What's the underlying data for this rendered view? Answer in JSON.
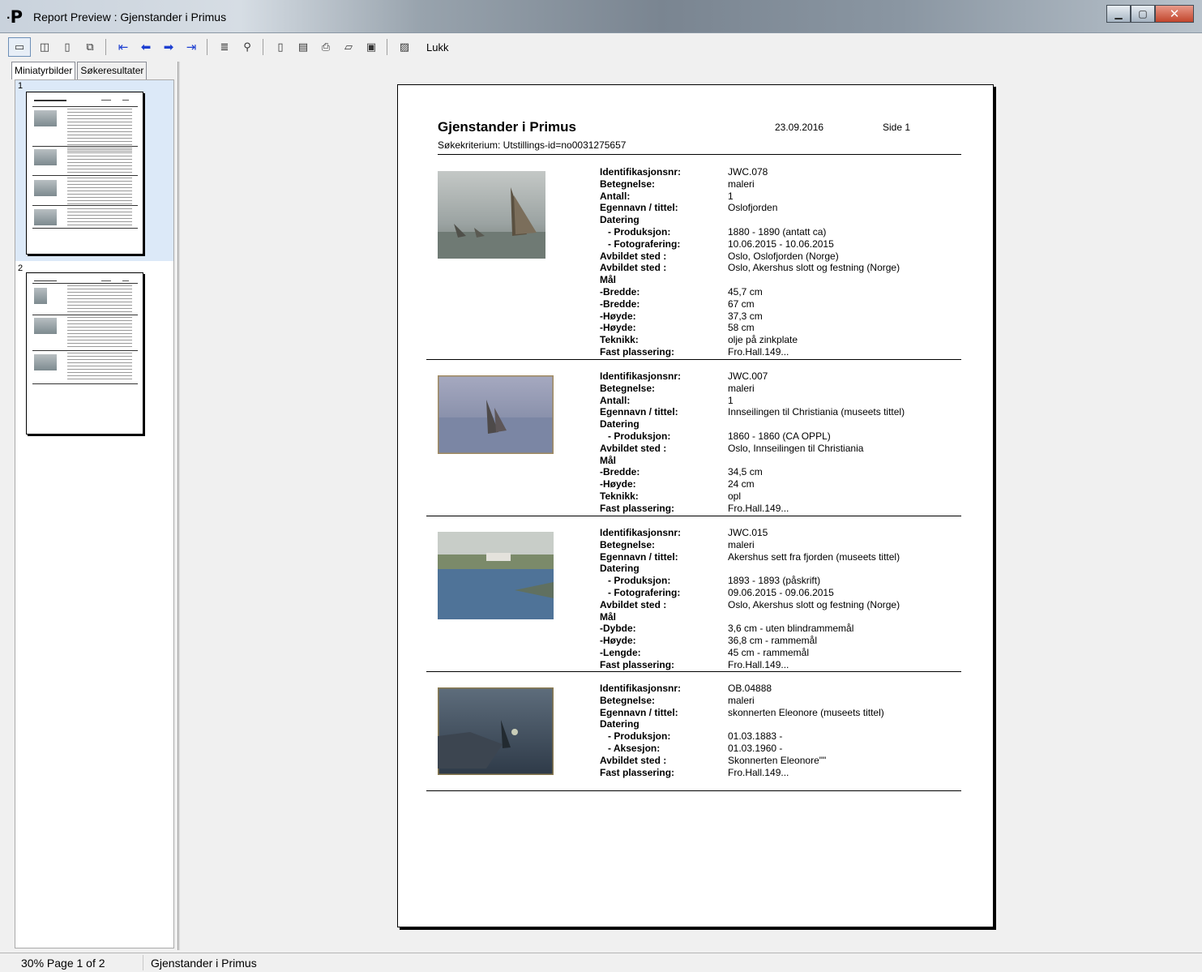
{
  "window": {
    "title": "Report Preview : Gjenstander i Primus",
    "app_icon": "P",
    "controls": [
      "minimize",
      "maximize",
      "close"
    ]
  },
  "toolbar": {
    "close_label": "Lukk",
    "icons": [
      "single-page-icon",
      "two-pages-icon",
      "page-width-icon",
      "multi-page-icon",
      "first-page-icon",
      "previous-page-icon",
      "next-page-icon",
      "last-page-icon",
      "goto-page-icon",
      "find-icon",
      "new-page-icon",
      "print-setup-icon",
      "print-icon",
      "open-icon",
      "save-icon",
      "export-icon"
    ]
  },
  "left_panel": {
    "tabs": [
      "Miniatyrbilder",
      "Søkeresultater"
    ],
    "active_tab": "Miniatyrbilder",
    "thumbnails": [
      {
        "number": "1"
      },
      {
        "number": "2"
      }
    ]
  },
  "report": {
    "title": "Gjenstander i Primus",
    "date": "23.09.2016",
    "page_label": "Side 1",
    "criterion": "Søkekriterium: Utstillings-id=no0031275657",
    "records": [
      {
        "image_desc": "seascape with sailing ship",
        "fields": [
          {
            "label": "Identifikasjonsnr:",
            "value": "JWC.078",
            "sub": false
          },
          {
            "label": "Betegnelse:",
            "value": "maleri",
            "sub": false
          },
          {
            "label": "Antall:",
            "value": "1",
            "sub": false
          },
          {
            "label": "Egennavn / tittel:",
            "value": "Oslofjorden",
            "sub": false
          },
          {
            "label": "Datering",
            "value": "",
            "sub": false
          },
          {
            "label": "- Produksjon:",
            "value": "1880 - 1890 (antatt ca)",
            "sub": true
          },
          {
            "label": "- Fotografering:",
            "value": "10.06.2015 - 10.06.2015",
            "sub": true
          },
          {
            "label": "Avbildet sted :",
            "value": "Oslo, Oslofjorden (Norge)",
            "sub": false
          },
          {
            "label": "Avbildet sted :",
            "value": "Oslo, Akershus slott og festning (Norge)",
            "sub": false
          },
          {
            "label": "Mål",
            "value": "",
            "sub": false
          },
          {
            "label": "-Bredde:",
            "value": "45,7 cm",
            "sub": false
          },
          {
            "label": "-Bredde:",
            "value": "67 cm",
            "sub": false
          },
          {
            "label": "-Høyde:",
            "value": "37,3 cm",
            "sub": false
          },
          {
            "label": "-Høyde:",
            "value": "58 cm",
            "sub": false
          },
          {
            "label": "Teknikk:",
            "value": "olje på zinkplate",
            "sub": false
          },
          {
            "label": "Fast plassering:",
            "value": "Fro.Hall.149...",
            "sub": false
          }
        ]
      },
      {
        "image_desc": "harbour entrance painting",
        "fields": [
          {
            "label": "Identifikasjonsnr:",
            "value": "JWC.007",
            "sub": false
          },
          {
            "label": "Betegnelse:",
            "value": "maleri",
            "sub": false
          },
          {
            "label": "Antall:",
            "value": "1",
            "sub": false
          },
          {
            "label": "Egennavn / tittel:",
            "value": "Innseilingen til Christiania (museets tittel)",
            "sub": false
          },
          {
            "label": "Datering",
            "value": "",
            "sub": false
          },
          {
            "label": "- Produksjon:",
            "value": "1860 - 1860 (CA OPPL)",
            "sub": true
          },
          {
            "label": "Avbildet sted :",
            "value": "Oslo, Innseilingen til Christiania",
            "sub": false
          },
          {
            "label": "Mål",
            "value": "",
            "sub": false
          },
          {
            "label": "-Bredde:",
            "value": "34,5 cm",
            "sub": false
          },
          {
            "label": "-Høyde:",
            "value": "24 cm",
            "sub": false
          },
          {
            "label": "Teknikk:",
            "value": "opl",
            "sub": false
          },
          {
            "label": "Fast plassering:",
            "value": "Fro.Hall.149...",
            "sub": false
          }
        ]
      },
      {
        "image_desc": "Akershus from the fjord",
        "fields": [
          {
            "label": "Identifikasjonsnr:",
            "value": "JWC.015",
            "sub": false
          },
          {
            "label": "Betegnelse:",
            "value": "maleri",
            "sub": false
          },
          {
            "label": "Egennavn / tittel:",
            "value": "Akershus sett fra fjorden (museets tittel)",
            "sub": false
          },
          {
            "label": "Datering",
            "value": "",
            "sub": false
          },
          {
            "label": "- Produksjon:",
            "value": "1893 - 1893 (påskrift)",
            "sub": true
          },
          {
            "label": "- Fotografering:",
            "value": "09.06.2015 - 09.06.2015",
            "sub": true
          },
          {
            "label": "Avbildet sted :",
            "value": "Oslo, Akershus slott og festning (Norge)",
            "sub": false
          },
          {
            "label": "Mål",
            "value": "",
            "sub": false
          },
          {
            "label": "-Dybde:",
            "value": "3,6 cm - uten blindrammemål",
            "sub": false
          },
          {
            "label": "-Høyde:",
            "value": "36,8 cm - rammemål",
            "sub": false
          },
          {
            "label": "-Lengde:",
            "value": "45 cm - rammemål",
            "sub": false
          },
          {
            "label": "Fast plassering:",
            "value": "Fro.Hall.149...",
            "sub": false
          }
        ]
      },
      {
        "image_desc": "schooner Eleonore at night",
        "fields": [
          {
            "label": "Identifikasjonsnr:",
            "value": "OB.04888",
            "sub": false
          },
          {
            "label": "Betegnelse:",
            "value": "maleri",
            "sub": false
          },
          {
            "label": "Egennavn / tittel:",
            "value": "skonnerten Eleonore (museets tittel)",
            "sub": false
          },
          {
            "label": "Datering",
            "value": "",
            "sub": false
          },
          {
            "label": "- Produksjon:",
            "value": "01.03.1883 -",
            "sub": true
          },
          {
            "label": "- Aksesjon:",
            "value": "01.03.1960 -",
            "sub": true
          },
          {
            "label": "Avbildet sted :",
            "value": "Skonnerten Eleonore\"\"",
            "sub": false
          },
          {
            "label": "Fast plassering:",
            "value": "Fro.Hall.149...",
            "sub": false
          }
        ]
      }
    ]
  },
  "status": {
    "zoom_page": "30%  Page 1 of 2",
    "report_name": "Gjenstander i Primus"
  }
}
